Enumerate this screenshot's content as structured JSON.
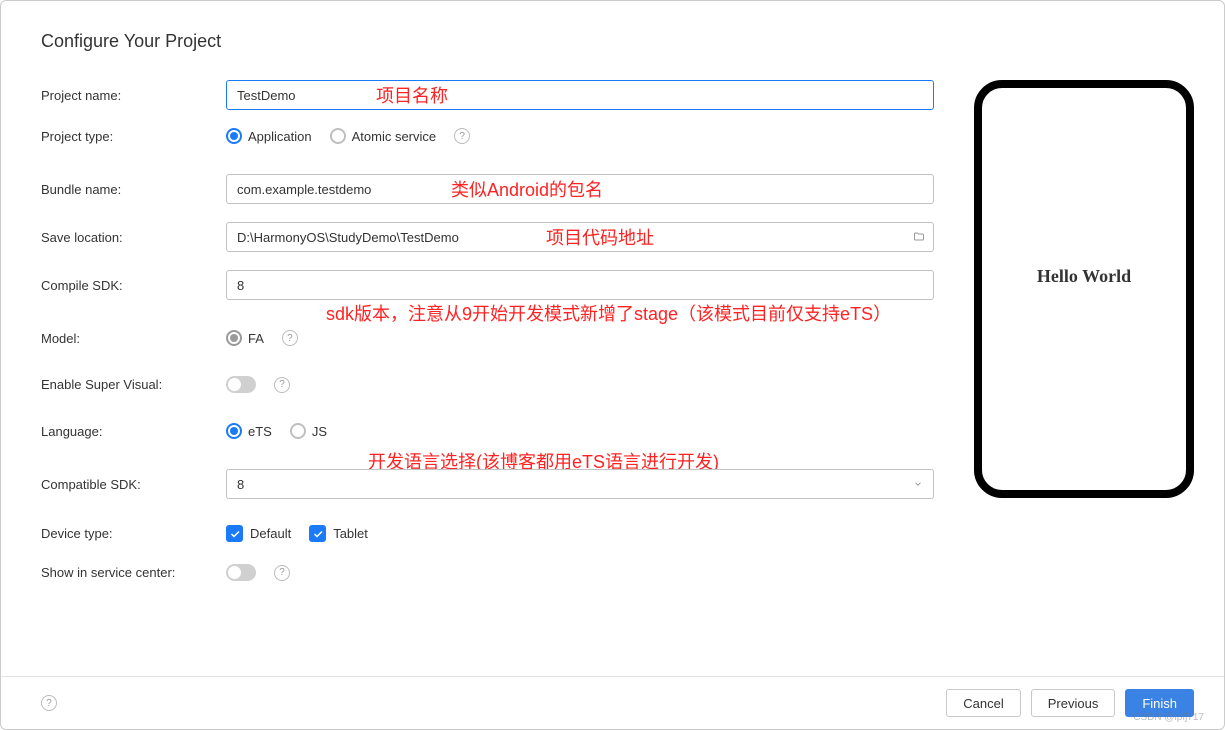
{
  "title": "Configure Your Project",
  "labels": {
    "project_name": "Project name:",
    "project_type": "Project type:",
    "bundle_name": "Bundle name:",
    "save_location": "Save location:",
    "compile_sdk": "Compile SDK:",
    "model": "Model:",
    "enable_super_visual": "Enable Super Visual:",
    "language": "Language:",
    "compatible_sdk": "Compatible SDK:",
    "device_type": "Device type:",
    "show_in_service_center": "Show in service center:"
  },
  "values": {
    "project_name": "TestDemo",
    "bundle_name": "com.example.testdemo",
    "save_location": "D:\\HarmonyOS\\StudyDemo\\TestDemo",
    "compile_sdk": "8",
    "compatible_sdk": "8"
  },
  "options": {
    "project_type": {
      "application": "Application",
      "atomic_service": "Atomic service"
    },
    "model": {
      "fa": "FA"
    },
    "language": {
      "ets": "eTS",
      "js": "JS"
    },
    "device_type": {
      "default": "Default",
      "tablet": "Tablet"
    }
  },
  "annotations": {
    "project_name": "项目名称",
    "bundle_name": "类似Android的包名",
    "save_location": "项目代码地址",
    "compile_sdk": "sdk版本，注意从9开始开发模式新增了stage（该模式目前仅支持eTS）",
    "language": "开发语言选择(该博客都用eTS语言进行开发)"
  },
  "preview": {
    "text": "Hello World"
  },
  "buttons": {
    "cancel": "Cancel",
    "previous": "Previous",
    "finish": "Finish"
  },
  "help_glyph": "?",
  "watermark": "CSDN @lpfj717"
}
